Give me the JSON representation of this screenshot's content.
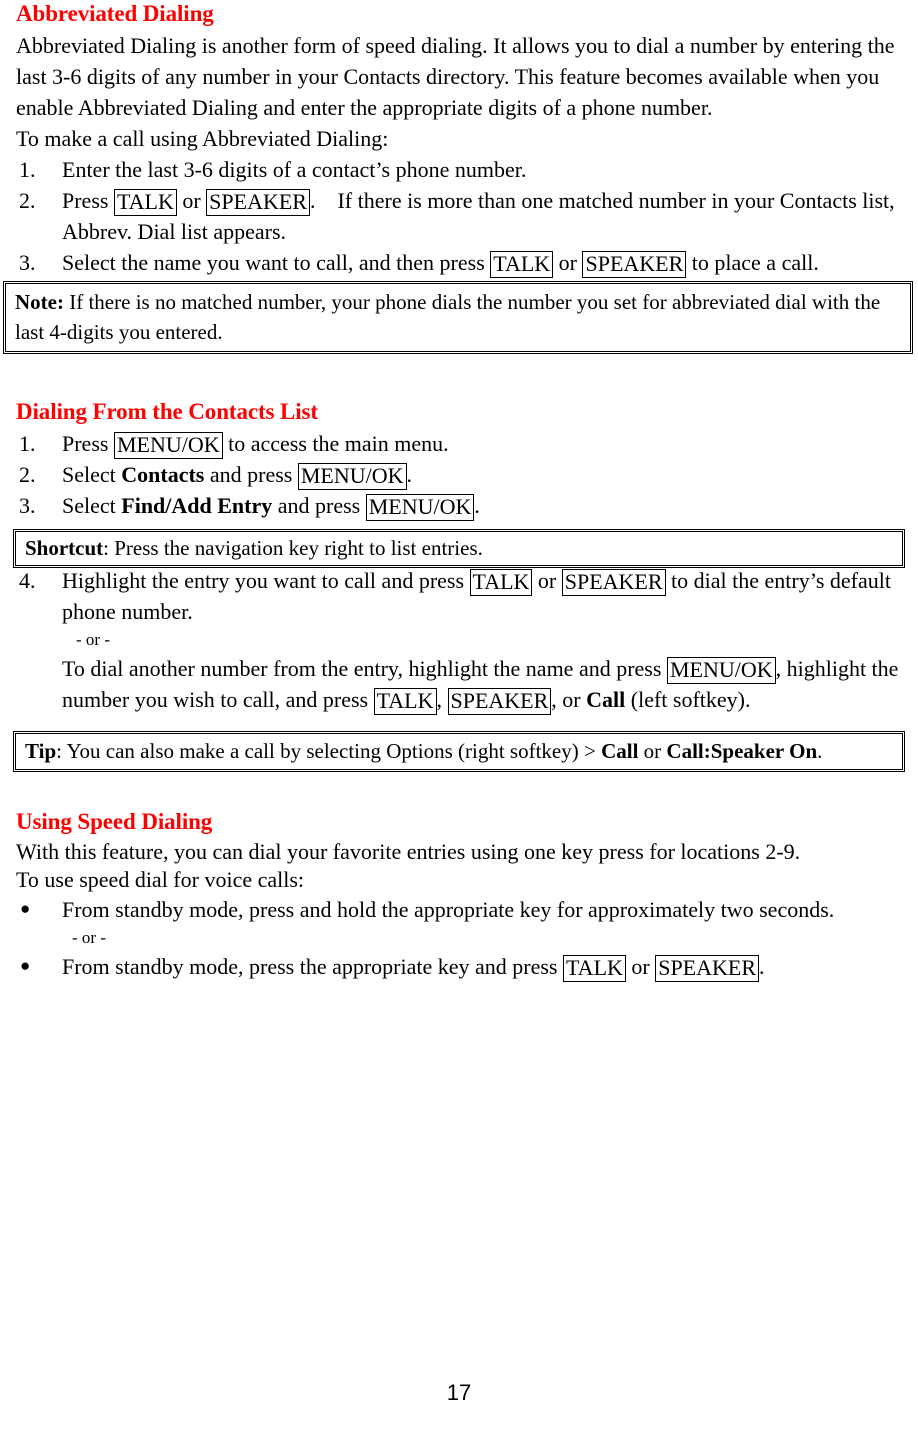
{
  "page": {
    "number": "17",
    "heading_color": "#ff0000",
    "text_color": "#000000"
  },
  "sections": [
    {
      "id": "abbreviated-dialing",
      "heading": "Abbreviated Dialing",
      "intro": "Abbreviated Dialing is another form of speed dialing. It allows you to dial a number by entering the last 3-6 digits of any number in your Contacts directory. This feature becomes available when you enable Abbreviated Dialing and enter the appropriate digits of a phone number.",
      "lead_in": "To make a call using Abbreviated Dialing:",
      "steps": [
        {
          "num": "1.",
          "pre": "Enter the last 3-6 digits of a contact’s phone number.",
          "keys": [],
          "post": ""
        },
        {
          "num": "2.",
          "pre": "Press ",
          "key1": "TALK",
          "mid": " or ",
          "key2": "SPEAKER",
          "post": ". If there is more than one matched number in your Contacts list, Abbrev. Dial list appears."
        },
        {
          "num": "3.",
          "pre": "Select the name you want to call, and then press ",
          "key1": "TALK",
          "mid": " or ",
          "key2": "SPEAKER",
          "post": " to place a call."
        }
      ],
      "callout": {
        "id": "note",
        "lead": "Note:",
        "text": " If there is no matched number, your phone dials the number you set for abbreviated dial with the last 4-digits you entered."
      }
    },
    {
      "id": "dialing-from-contacts-list",
      "heading": "Dialing From the Contacts List",
      "steps": [
        {
          "num": "1.",
          "pre": "Press ",
          "key1": "MENU/OK",
          "post": " to access the main menu."
        },
        {
          "num": "2.",
          "pre": "Select ",
          "bold1": "Contacts",
          "mid": " and press ",
          "key1": "MENU/OK",
          "post": "."
        },
        {
          "num": "3.",
          "pre": "Select ",
          "bold1": "Find/Add Entry",
          "mid": " and press ",
          "key1": "MENU/OK",
          "post": "."
        }
      ],
      "shortcut_callout": {
        "id": "shortcut",
        "lead": "Shortcut",
        "text": ": Press the navigation key right to list entries."
      },
      "step4": {
        "num": "4.",
        "pre": "Highlight the entry you want to call and press ",
        "key1": "TALK",
        "mid": " or ",
        "key2": "SPEAKER",
        "post": " to dial the entry’s default phone number.",
        "or_text": "- or -",
        "alt_pre": "To dial another number from the entry, highlight the name and press ",
        "alt_key1": "MENU/OK",
        "alt_mid": ", highlight the number you wish to call, and press ",
        "alt_key2": "TALK",
        "alt_mid2": ", ",
        "alt_key3": "SPEAKER",
        "alt_mid3": ", or ",
        "alt_bold": "Call",
        "alt_post": " (left softkey)."
      },
      "tip_callout": {
        "id": "tip",
        "lead": "Tip",
        "text1": ": You can also make a call by selecting Options (right softkey) > ",
        "bold1": "Call",
        "text2": " or ",
        "bold2": "Call:Speaker On",
        "text3": "."
      }
    },
    {
      "id": "using-speed-dialing",
      "heading": "Using Speed Dialing",
      "intro": "With this feature, you can dial your favorite entries using one key press for locations 2-9.",
      "lead_in": "To use speed dial for voice calls:",
      "bullets": [
        {
          "bullet": "●",
          "pre": "From standby mode, press and hold the appropriate key for approximately two seconds.",
          "or_text": "- or -"
        },
        {
          "bullet": "●",
          "pre": "From standby mode, press the appropriate key and press ",
          "key1": "TALK",
          "mid": " or ",
          "key2": "SPEAKER",
          "post": "."
        }
      ]
    }
  ]
}
